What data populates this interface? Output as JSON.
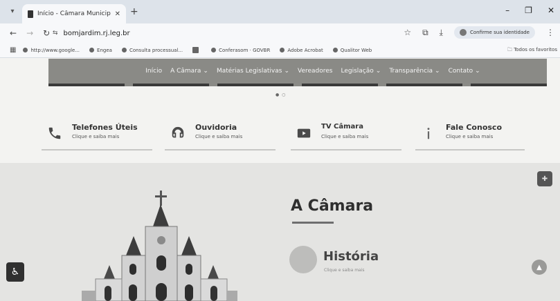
{
  "browser": {
    "tab_title": "Início - Câmara Municipal de B",
    "tab_close": "✕",
    "new_tab": "+",
    "url": "bomjardim.rj.leg.br",
    "profile_label": "Confirme sua identidade",
    "bookmarks": [
      "http://www.google...",
      "Engea",
      "Consulta processual...",
      "",
      "Conferasom · GOVBR",
      "Adobe Acrobat",
      "Qualitor Web"
    ],
    "all_bookmarks": "Todos os favoritos"
  },
  "nav": {
    "items": [
      {
        "label": "Início",
        "dropdown": false
      },
      {
        "label": "A Câmara",
        "dropdown": true
      },
      {
        "label": "Matérias Legislativas",
        "dropdown": true
      },
      {
        "label": "Vereadores",
        "dropdown": false
      },
      {
        "label": "Legislação",
        "dropdown": true
      },
      {
        "label": "Transparência",
        "dropdown": true
      },
      {
        "label": "Contato",
        "dropdown": true
      }
    ]
  },
  "quick_links": [
    {
      "title": "Telefones Úteis",
      "subtitle": "Clique e saiba mais",
      "icon": "phone-icon"
    },
    {
      "title": "Ouvidoria",
      "subtitle": "Clique e saiba mais",
      "icon": "headset-icon"
    },
    {
      "title": "TV Câmara",
      "subtitle": "Clique e saiba mais",
      "icon": "video-icon"
    },
    {
      "title": "Fale Conosco",
      "subtitle": "Clique e saiba mais",
      "icon": "info-icon"
    }
  ],
  "main": {
    "section_title": "A Câmara",
    "history_title": "História",
    "history_subtitle": "Clique e saiba mais"
  }
}
